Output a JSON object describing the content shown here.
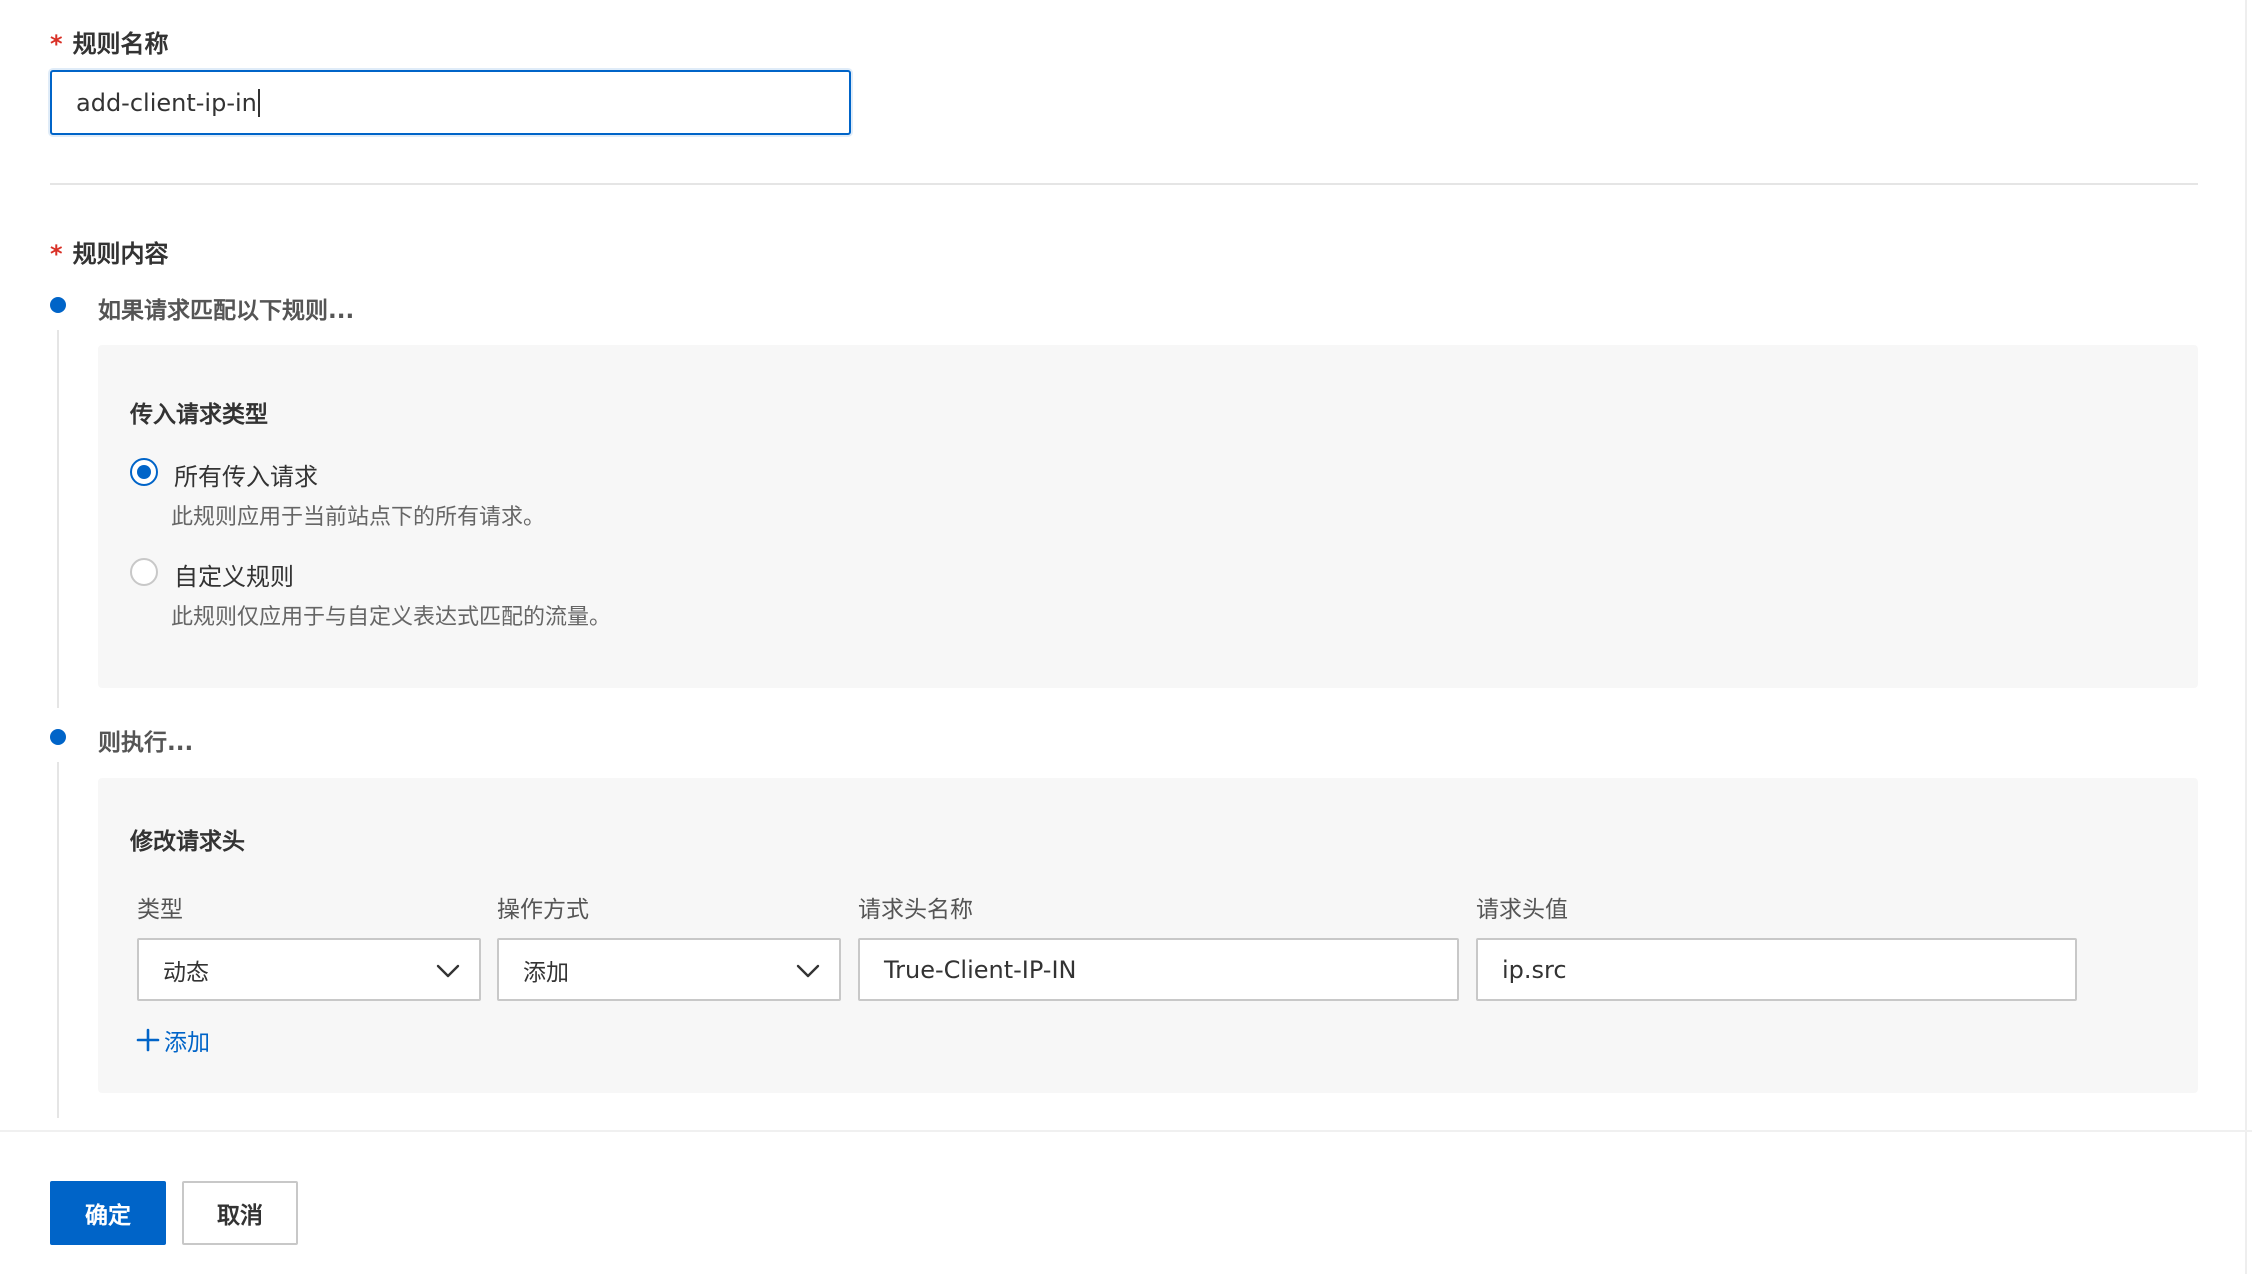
{
  "form": {
    "rule_name": {
      "required_mark": "*",
      "label": "规则名称",
      "value": "add-client-ip-in"
    },
    "rule_content": {
      "required_mark": "*",
      "label": "规则内容"
    }
  },
  "condition": {
    "step_title": "如果请求匹配以下规则...",
    "panel_title": "传入请求类型",
    "options": [
      {
        "label": "所有传入请求",
        "description": "此规则应用于当前站点下的所有请求。",
        "checked": true
      },
      {
        "label": "自定义规则",
        "description": "此规则仅应用于与自定义表达式匹配的流量。",
        "checked": false
      }
    ]
  },
  "action": {
    "step_title": "则执行...",
    "panel_title": "修改请求头",
    "columns": {
      "type": "类型",
      "operation": "操作方式",
      "header_name": "请求头名称",
      "header_value": "请求头值"
    },
    "row": {
      "type": "动态",
      "operation": "添加",
      "header_name": "True-Client-IP-IN",
      "header_value": "ip.src"
    },
    "add_label": "添加"
  },
  "footer": {
    "confirm": "确定",
    "cancel": "取消"
  },
  "colors": {
    "primary": "#0064c8",
    "required": "#d93026",
    "panel_bg": "#f7f7f7"
  },
  "icons": {
    "dropdown": "chevron-down-icon",
    "add": "plus-icon"
  }
}
